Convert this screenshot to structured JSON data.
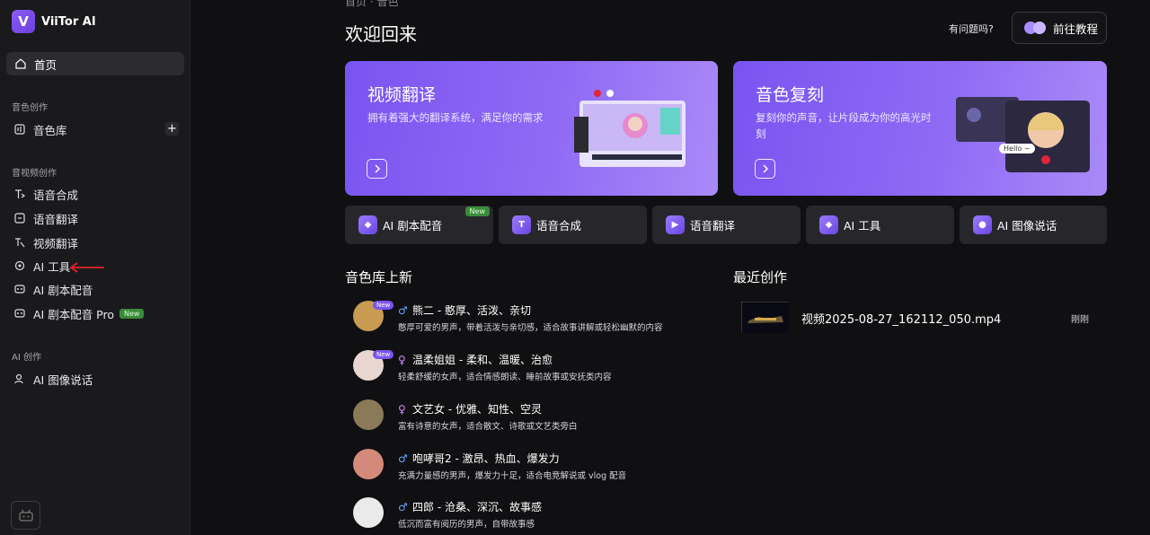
{
  "app": {
    "name": "ViiTor AI",
    "logo_letter": "V"
  },
  "sidebar": {
    "home": "首页",
    "sections": [
      {
        "label": "音色创作"
      },
      {
        "label": "音视频创作"
      },
      {
        "label": "AI 创作"
      }
    ],
    "voice_library": "音色库",
    "items": [
      {
        "label": "语音合成"
      },
      {
        "label": "语音翻译"
      },
      {
        "label": "视频翻译"
      },
      {
        "label": "AI 工具"
      },
      {
        "label": "AI 剧本配音"
      },
      {
        "label": "AI 剧本配音 Pro",
        "tag": "New"
      }
    ],
    "ai_image": "AI 图像说话"
  },
  "header": {
    "top_cut": "首页 · 音色",
    "welcome": "欢迎回来",
    "help_text": "有问题吗?",
    "tutorial_btn": "前往教程"
  },
  "heroes": [
    {
      "title": "视频翻译",
      "desc": "拥有着强大的翻译系统，满足你的需求"
    },
    {
      "title": "音色复刻",
      "desc": "复刻你的声音，让片段成为你的高光时刻",
      "art_label": "Hello ~"
    }
  ],
  "tools": [
    {
      "label": "AI 剧本配音",
      "tag": "New"
    },
    {
      "label": "语音合成"
    },
    {
      "label": "语音翻译"
    },
    {
      "label": "AI 工具"
    },
    {
      "label": "AI 图像说话"
    }
  ],
  "voice_section": {
    "title": "音色库上新",
    "voices": [
      {
        "name": "熊二 - 憨厚、活泼、亲切",
        "desc": "憨厚可爱的男声，带着活泼与亲切感，适合故事讲解或轻松幽默的内容",
        "gender": "♂",
        "tag": "New",
        "color": "#c89a52"
      },
      {
        "name": "温柔姐姐 - 柔和、温暖、治愈",
        "desc": "轻柔舒缓的女声，适合情感朗读、睡前故事或安抚类内容",
        "gender": "♀",
        "tag": "New",
        "color": "#e8d6d0"
      },
      {
        "name": "文艺女 - 优雅、知性、空灵",
        "desc": "富有诗意的女声，适合散文、诗歌或文艺类旁白",
        "gender": "♀",
        "color": "#8a7a58"
      },
      {
        "name": "咆哮哥2 - 激昂、热血、爆发力",
        "desc": "充满力量感的男声，爆发力十足，适合电竞解说或 vlog 配音",
        "gender": "♂",
        "color": "#d48a7a"
      },
      {
        "name": "四郎 - 沧桑、深沉、故事感",
        "desc": "低沉而富有阅历的男声，自带故事感",
        "gender": "♂",
        "color": "#eaeaea"
      }
    ]
  },
  "recent_section": {
    "title": "最近创作",
    "items": [
      {
        "name": "视频2025-08-27_162112_050.mp4",
        "time": "刚刚"
      }
    ]
  },
  "colors": {
    "accent": "#7a54f0",
    "male": "#6aa8ff",
    "female": "#d28cff"
  }
}
